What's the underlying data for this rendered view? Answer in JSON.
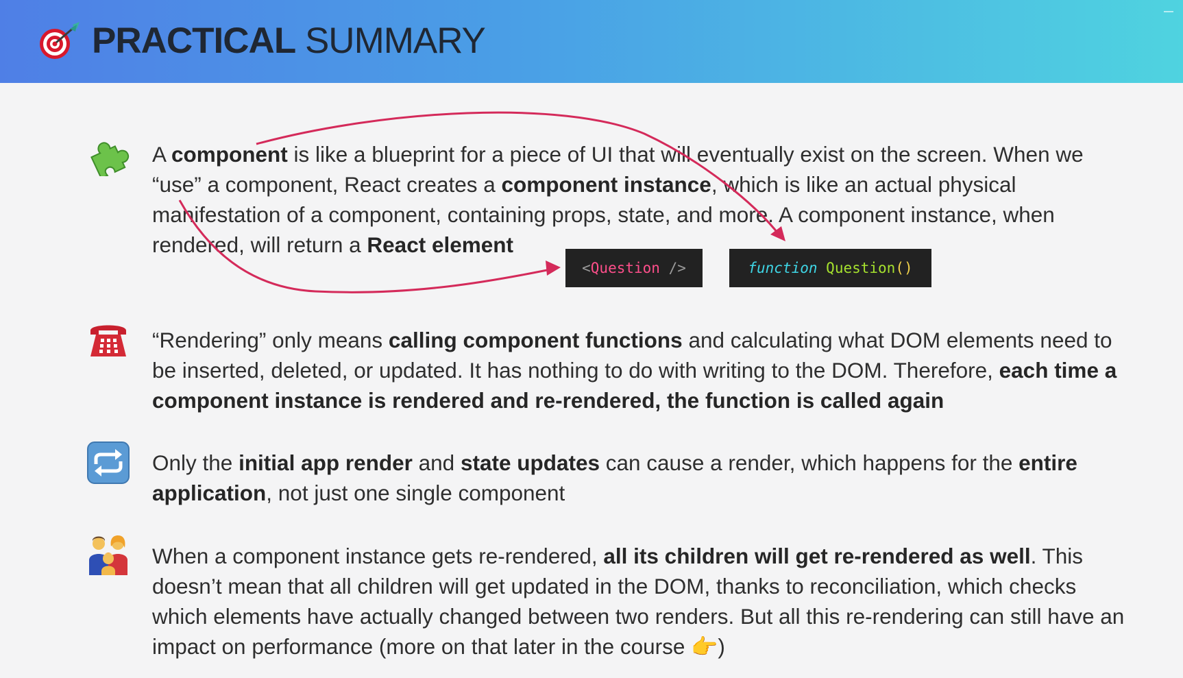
{
  "header": {
    "icon": "target-dart-icon",
    "title_bold": "PRACTICAL",
    "title_light": "SUMMARY"
  },
  "colors": {
    "header_gradient_start": "#4f7fe6",
    "header_gradient_end": "#4fd3e0",
    "arrow": "#d42a5a",
    "code_bg": "#222222"
  },
  "bullets": [
    {
      "icon": "puzzle-piece-icon",
      "parts": [
        {
          "t": "A ",
          "b": false
        },
        {
          "t": "component",
          "b": true
        },
        {
          "t": " is like a blueprint for a piece of UI that will eventually exist on the screen. When we “use” a component, React creates a ",
          "b": false
        },
        {
          "t": "component instance",
          "b": true
        },
        {
          "t": ", which is like an actual physical manifestation of a component, containing props, state, and more. A component instance, when rendered, will return a ",
          "b": false
        },
        {
          "t": "React element",
          "b": true
        }
      ]
    },
    {
      "icon": "telephone-icon",
      "parts": [
        {
          "t": "“Rendering” only means ",
          "b": false
        },
        {
          "t": "calling component functions",
          "b": true
        },
        {
          "t": " and calculating what DOM elements need to be inserted, deleted, or updated. It has nothing to do with writing to the DOM. Therefore, ",
          "b": false
        },
        {
          "t": "each time a component instance is rendered and re-rendered, the function is called again",
          "b": true
        }
      ]
    },
    {
      "icon": "repeat-arrows-icon",
      "parts": [
        {
          "t": "Only the ",
          "b": false
        },
        {
          "t": "initial app render",
          "b": true
        },
        {
          "t": " and ",
          "b": false
        },
        {
          "t": "state updates",
          "b": true
        },
        {
          "t": " can cause a render, which happens for the ",
          "b": false
        },
        {
          "t": "entire application",
          "b": true
        },
        {
          "t": ", not just one single component",
          "b": false
        }
      ]
    },
    {
      "icon": "family-icon",
      "parts": [
        {
          "t": "When a component instance gets re-rendered, ",
          "b": false
        },
        {
          "t": "all its children will get re-rendered as well",
          "b": true
        },
        {
          "t": ". This doesn’t mean that all children will get updated in the DOM, thanks to reconciliation, which checks which elements have actually changed between two renders. But all this re-rendering can still have an impact on performance (more on that later in the course 👉)",
          "b": false
        }
      ]
    }
  ],
  "code": {
    "jsx_open": "<",
    "jsx_name": "Question",
    "jsx_close": " />",
    "fn_keyword": "function",
    "fn_name": "Question",
    "fn_parens": "()"
  }
}
